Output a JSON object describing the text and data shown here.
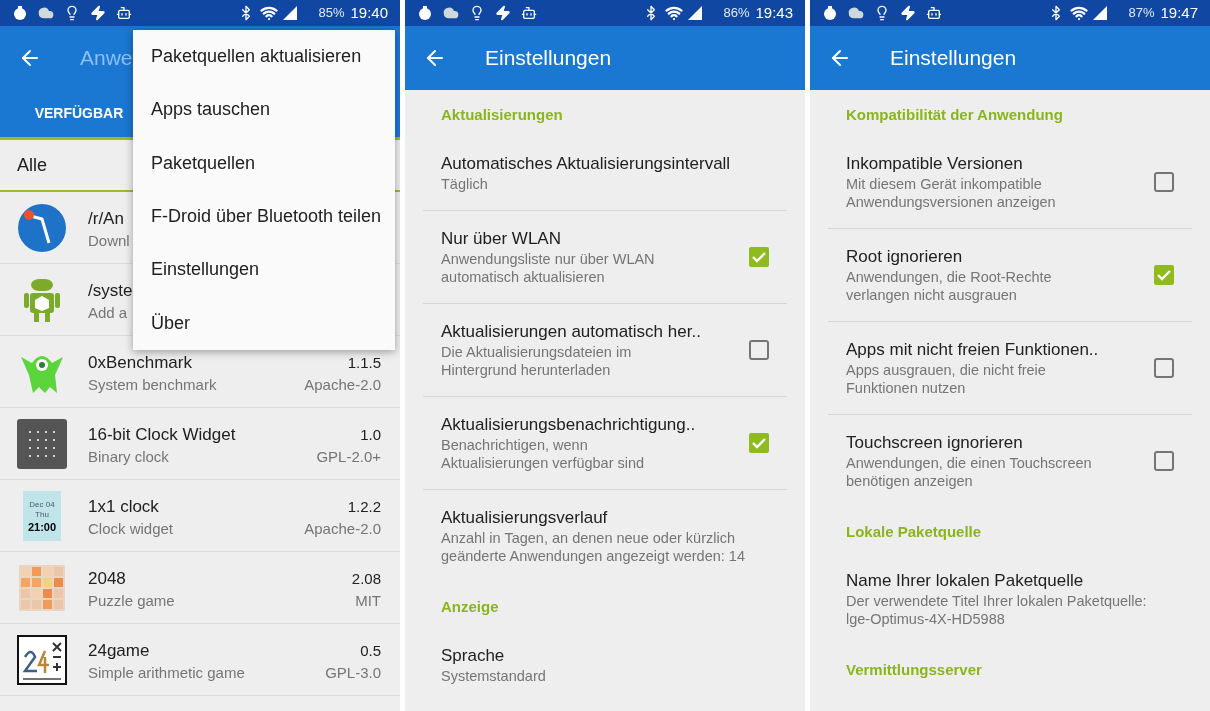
{
  "panels": [
    {
      "kind": "app_list",
      "status": {
        "battery": "85%",
        "time": "19:40"
      },
      "toolbar": {
        "title": "Anwe"
      },
      "tabs": [
        {
          "label": "VERFÜGBAR",
          "selected": true
        }
      ],
      "filter": "Alle",
      "apps": [
        {
          "name": "/r/An",
          "summary": "Downl"
        },
        {
          "name": "/syste",
          "summary": "Add a"
        },
        {
          "name": "0xBenchmark",
          "summary": "System benchmark",
          "version": "1.1.5",
          "license": "Apache-2.0"
        },
        {
          "name": "16-bit Clock Widget",
          "summary": "Binary clock",
          "version": "1.0",
          "license": "GPL-2.0+"
        },
        {
          "name": "1x1 clock",
          "summary": "Clock widget",
          "version": "1.2.2",
          "license": "Apache-2.0",
          "icon_text": [
            "Dec 04",
            "Thu",
            "21:00"
          ]
        },
        {
          "name": "2048",
          "summary": "Puzzle game",
          "version": "2.08",
          "license": "MIT"
        },
        {
          "name": "24game",
          "summary": "Simple arithmetic game",
          "version": "0.5",
          "license": "GPL-3.0"
        }
      ],
      "menu": [
        "Paketquellen aktualisieren",
        "Apps tauschen",
        "Paketquellen",
        "F-Droid über Bluetooth teilen",
        "Einstellungen",
        "Über"
      ]
    },
    {
      "kind": "settings",
      "status": {
        "battery": "86%",
        "time": "19:43"
      },
      "toolbar": {
        "title": "Einstellungen"
      },
      "sections": [
        {
          "title": "Aktualisierungen",
          "items": [
            {
              "kind": "plain",
              "title": "Automatisches Aktualisierungsintervall",
              "summary": "Täglich"
            },
            {
              "kind": "checkbox",
              "title": "Nur über WLAN",
              "summary": "Anwendungsliste nur über WLAN automatisch aktualisieren",
              "checked": true
            },
            {
              "kind": "checkbox",
              "title": "Aktualisierungen automatisch her..",
              "summary": "Die Aktualisierungsdateien im Hintergrund herunterladen",
              "checked": false
            },
            {
              "kind": "checkbox",
              "title": "Aktualisierungsbenachrichtigung..",
              "summary": "Benachrichtigen, wenn Aktualisierungen verfügbar sind",
              "checked": true
            },
            {
              "kind": "plain",
              "title": "Aktualisierungsverlauf",
              "summary": "Anzahl in Tagen, an denen neue oder kürzlich geänderte Anwendungen angezeigt werden: 14"
            }
          ]
        },
        {
          "title": "Anzeige",
          "items": [
            {
              "kind": "plain",
              "title": "Sprache",
              "summary": "Systemstandard"
            }
          ]
        }
      ]
    },
    {
      "kind": "settings",
      "status": {
        "battery": "87%",
        "time": "19:47"
      },
      "toolbar": {
        "title": "Einstellungen"
      },
      "sections": [
        {
          "title": "Kompatibilität der Anwendung",
          "items": [
            {
              "kind": "checkbox",
              "title": "Inkompatible Versionen",
              "summary": "Mit diesem Gerät inkompatible Anwendungsversionen anzeigen",
              "checked": false
            },
            {
              "kind": "checkbox",
              "title": "Root ignorieren",
              "summary": "Anwendungen, die Root-Rechte verlangen nicht ausgrauen",
              "checked": true
            },
            {
              "kind": "checkbox",
              "title": "Apps mit nicht freien Funktionen..",
              "summary": "Apps ausgrauen, die nicht freie Funktionen nutzen",
              "checked": false
            },
            {
              "kind": "checkbox",
              "title": "Touchscreen ignorieren",
              "summary": "Anwendungen, die einen Touchscreen benötigen anzeigen",
              "checked": false
            }
          ]
        },
        {
          "title": "Lokale Paketquelle",
          "items": [
            {
              "kind": "plain",
              "title": "Name Ihrer lokalen Paketquelle",
              "summary": "Der verwendete Titel Ihrer lokalen Paketquelle: lge-Optimus-4X-HD5988"
            }
          ]
        },
        {
          "title": "Vermittlungsserver"
        }
      ]
    }
  ]
}
